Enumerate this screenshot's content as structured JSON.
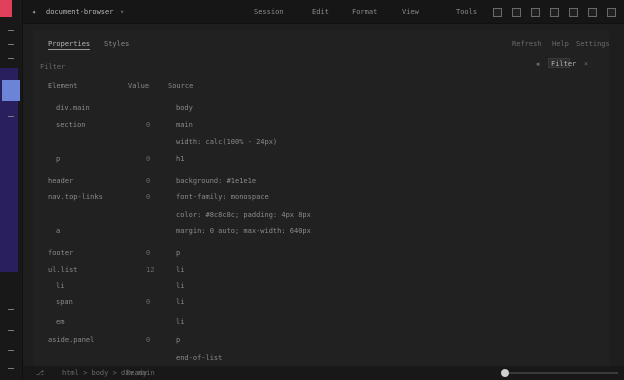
{
  "titlebar": {
    "title": "document-browser",
    "menus": [
      "Session",
      "Edit",
      "Format",
      "View",
      "Tools"
    ]
  },
  "tabs": [
    "Properties",
    "Styles"
  ],
  "toolbar": [
    "Refresh",
    "Help",
    "Settings"
  ],
  "filter": {
    "label": "Filter",
    "value": "Filter"
  },
  "columns": [
    "Element",
    "Value",
    "Source"
  ],
  "rows": [
    {
      "element": "div.main",
      "value": "",
      "source": "body"
    },
    {
      "element": "section",
      "value": "0",
      "source": "main"
    },
    {
      "element": "",
      "value": "",
      "source": "width: calc(100% - 24px)"
    },
    {
      "element": "p",
      "value": "0",
      "source": "h1"
    },
    {
      "element": "header",
      "value": "0",
      "source": "background: #1e1e1e"
    },
    {
      "element": "nav.top-links",
      "value": "0",
      "source": "font-family: monospace"
    },
    {
      "element": "",
      "value": "",
      "source": "color: #8c8c8c; padding: 4px 8px"
    },
    {
      "element": "a",
      "value": "",
      "source": "margin: 0 auto; max-width: 640px"
    },
    {
      "element": "footer",
      "value": "0",
      "source": "p"
    },
    {
      "element": "ul.list",
      "value": "12",
      "source": "li"
    },
    {
      "element": "li",
      "value": "",
      "source": "li"
    },
    {
      "element": "span",
      "value": "0",
      "source": "li"
    },
    {
      "element": "em",
      "value": "",
      "source": "li"
    },
    {
      "element": "aside.panel",
      "value": "0",
      "source": "p"
    },
    {
      "element": "",
      "value": "",
      "source": "end-of-list"
    }
  ],
  "footer": {
    "path": "html > body > div.main",
    "status": "Ready"
  }
}
